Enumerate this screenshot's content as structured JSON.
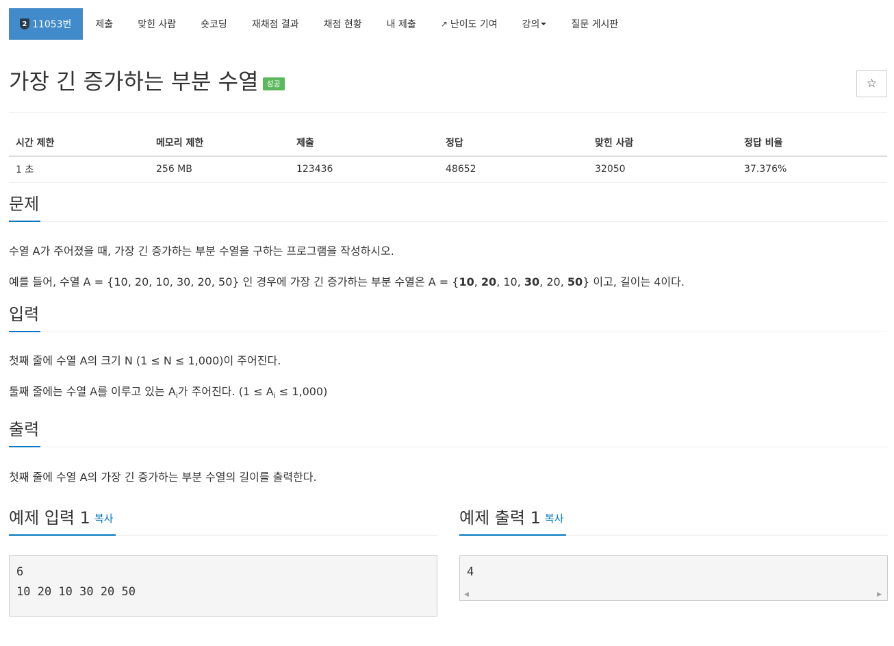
{
  "nav": {
    "problem_tab": {
      "tier": "2",
      "label": "11053번"
    },
    "tabs": [
      "제출",
      "맞힌 사람",
      "숏코딩",
      "재채점 결과",
      "채점 현황",
      "내 제출",
      "난이도 기여",
      "강의",
      "질문 게시판"
    ]
  },
  "problem": {
    "title": "가장 긴 증가하는 부분 수열",
    "status_badge": "성공",
    "star_symbol": "☆"
  },
  "info_table": {
    "headers": [
      "시간 제한",
      "메모리 제한",
      "제출",
      "정답",
      "맞힌 사람",
      "정답 비율"
    ],
    "values": [
      "1 초",
      "256 MB",
      "123436",
      "48652",
      "32050",
      "37.376%"
    ]
  },
  "sections": {
    "description": {
      "heading": "문제",
      "p1": "수열 A가 주어졌을 때, 가장 긴 증가하는 부분 수열을 구하는 프로그램을 작성하시오.",
      "p2_prefix": "예를 들어, 수열 A = {10, 20, 10, 30, 20, 50} 인 경우에 가장 긴 증가하는 부분 수열은 A = {",
      "seq": [
        "10",
        "20",
        "10",
        "30",
        "20",
        "50"
      ],
      "seq_bold": [
        true,
        true,
        false,
        true,
        false,
        true
      ],
      "sep": ", ",
      "p2_suffix": "} 이고, 길이는 4이다."
    },
    "input": {
      "heading": "입력",
      "p1": "첫째 줄에 수열 A의 크기 N (1 ≤ N ≤ 1,000)이 주어진다.",
      "p2_a": "둘째 줄에는 수열 A를 이루고 있는 A",
      "p2_sub1": "i",
      "p2_b": "가 주어진다. (1 ≤ A",
      "p2_sub2": "i",
      "p2_c": " ≤ 1,000)"
    },
    "output": {
      "heading": "출력",
      "p1": "첫째 줄에 수열 A의 가장 긴 증가하는 부분 수열의 길이를 출력한다."
    }
  },
  "samples": {
    "input": {
      "heading": "예제 입력 1",
      "copy": "복사",
      "content": "6\n10 20 10 30 20 50"
    },
    "output": {
      "heading": "예제 출력 1",
      "copy": "복사",
      "content": "4"
    }
  },
  "colors": {
    "nav_active": "#428bca",
    "badge_success": "#5cb85c",
    "accent": "#0076c0"
  },
  "icons": {
    "external_link": "external-link-icon",
    "star": "star-icon",
    "tier": "tier-badge-icon",
    "dropdown": "caret-down-icon"
  }
}
